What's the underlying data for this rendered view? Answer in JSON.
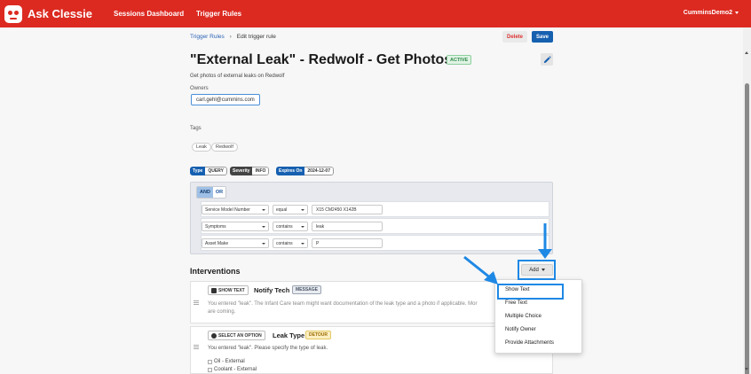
{
  "app": {
    "name": "Ask Clessie",
    "nav": [
      "Sessions Dashboard",
      "Trigger Rules"
    ],
    "user": "CumminsDemo2"
  },
  "breadcrumb": {
    "parent": "Trigger Rules",
    "separator": "›",
    "current": "Edit trigger rule"
  },
  "actions": {
    "delete": "Delete",
    "save": "Save"
  },
  "rule": {
    "title": "\"External Leak\" - Redwolf - Get Photos",
    "status": "ACTIVE",
    "description": "Get photos of external leaks on Redwolf",
    "owners_label": "Owners",
    "owner": "carl.gehl@cummins.com",
    "tags_label": "Tags",
    "tags": [
      "Leak",
      "Redwolf"
    ],
    "meta": {
      "type_label": "Type",
      "type_value": "QUERY",
      "severity_label": "Severity",
      "severity_value": "INFO",
      "expires_label": "Expires On",
      "expires_value": "2024-12-07"
    }
  },
  "conditions": {
    "and_label": "AND",
    "or_label": "OR",
    "rows": [
      {
        "field": "Service Model Number",
        "operator": "equal",
        "value": "X15 CM2450 X142B"
      },
      {
        "field": "Symptoms",
        "operator": "contains",
        "value": "leak"
      },
      {
        "field": "Asset Make",
        "operator": "contains",
        "value": "P"
      }
    ]
  },
  "interventions": {
    "title": "Interventions",
    "add_label": "Add",
    "cards": [
      {
        "type": "SHOW TEXT",
        "name": "Notify Tech",
        "badge": "MESSAGE",
        "text_line1": "You entered \"leak\". The Infant Care team might want documentation of the leak type and a photo if applicable. Mor",
        "text_line2": "are coming."
      },
      {
        "type": "SELECT AN OPTION",
        "name": "Leak Type",
        "badge": "DETOUR",
        "prompt": "You entered \"leak\". Please specify the type of leak.",
        "options": [
          "Oil - External",
          "Coolant - External"
        ]
      }
    ],
    "menu": [
      "Show Text",
      "Free Text",
      "Multiple Choice",
      "Notify Owner",
      "Provide Attachments"
    ]
  },
  "colors": {
    "navbar": "#dc2a21",
    "primary": "#1660b0",
    "annotation": "#1e88e5",
    "active_badge": "#2e8b4a",
    "detour_badge": "#fcefc2"
  }
}
